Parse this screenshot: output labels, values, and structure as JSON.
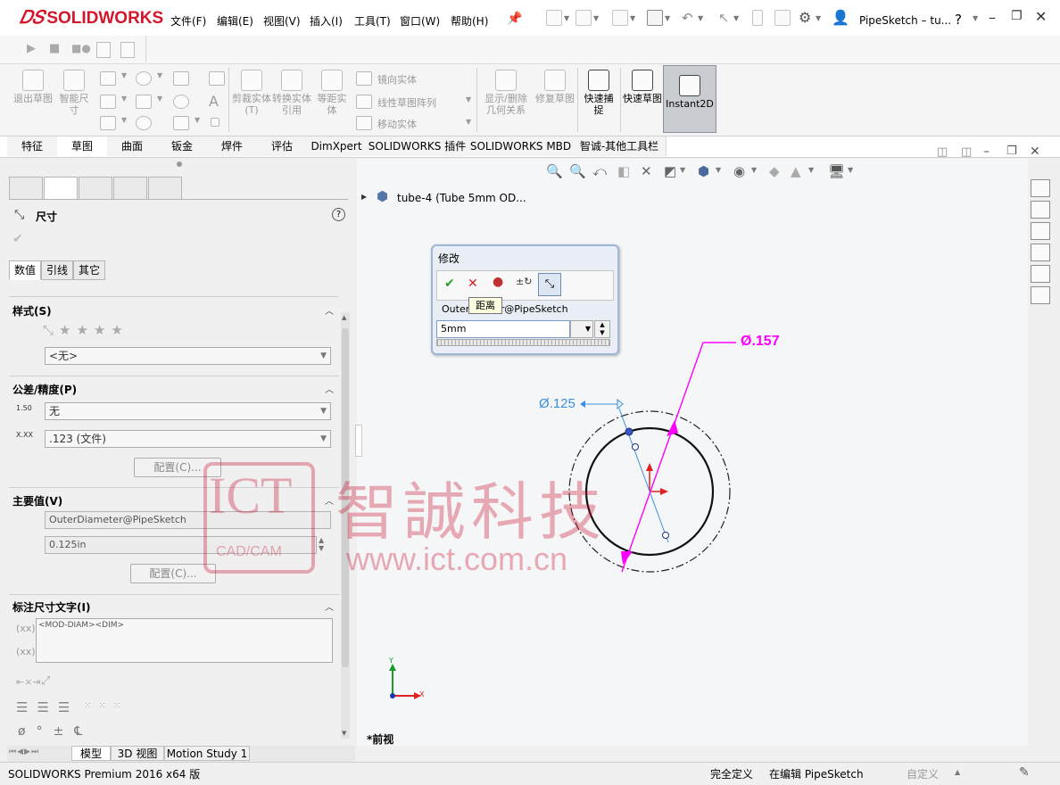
{
  "app": {
    "brand": "SOLIDWORKS",
    "title": "PipeSketch – tu...",
    "help": "?"
  },
  "menu": [
    "文件(F)",
    "编辑(E)",
    "视图(V)",
    "插入(I)",
    "工具(T)",
    "窗口(W)",
    "帮助(H)"
  ],
  "ribbon": {
    "exit_sketch": "退出草图",
    "smart_dim": "智能尺寸",
    "trim": "剪裁实体(T)",
    "convert": "转换实体引用",
    "offset": "等距实体",
    "mirror": "镜向实体",
    "linear_pattern": "线性草图阵列",
    "move": "移动实体",
    "show_hide": "显示/删除几何关系",
    "repair": "修复草图",
    "quick_snap": "快速捕捉",
    "rapid_sketch": "快速草图",
    "instant2d": "Instant2D"
  },
  "tabs": [
    "特征",
    "草图",
    "曲面",
    "钣金",
    "焊件",
    "评估",
    "DimXpert",
    "SOLIDWORKS 插件",
    "SOLIDWORKS MBD",
    "智诚-其他工具栏"
  ],
  "active_tab": "草图",
  "panel": {
    "title": "尺寸",
    "help": "?",
    "subtabs": [
      "数值",
      "引线",
      "其它"
    ],
    "style": {
      "header": "样式(S)",
      "value": "<无>"
    },
    "tolerance": {
      "header": "公差/精度(P)",
      "tol_icon": "1.50",
      "tol_value": "无",
      "prec_value": ".123 (文件)",
      "config_btn": "配置(C)..."
    },
    "primary": {
      "header": "主要值(V)",
      "name": "OuterDiameter@PipeSketch",
      "value": "0.125in",
      "config_btn": "配置(C)..."
    },
    "dimtext": {
      "header": "标注尺寸文字(I)",
      "value": "<MOD-DIAM><DIM>"
    }
  },
  "tree": {
    "item": "tube-4  (Tube 5mm OD..."
  },
  "modify": {
    "title": "修改",
    "tooltip": "距离",
    "name_left": "Outer",
    "name_right": "er@PipeSketch",
    "value": "5mm"
  },
  "sketch": {
    "dim_outer": "Ø.157",
    "dim_inner": "Ø.125",
    "axis_x": "X",
    "axis_y": "Y",
    "view_label": "*前视"
  },
  "watermark": {
    "ict": "ICT",
    "cadcam": "CAD/CAM",
    "cn": "智誠科技",
    "url": "www.ict.com.cn"
  },
  "bottom_tabs": [
    "模型",
    "3D 视图",
    "Motion Study 1"
  ],
  "status": {
    "product": "SOLIDWORKS Premium 2016 x64 版",
    "defined": "完全定义",
    "editing": "在编辑 PipeSketch",
    "custom": "自定义"
  },
  "colors": {
    "brand_red": "#d4162b",
    "magenta": "#ff00ff",
    "blue_dim": "#3b8fe0"
  }
}
